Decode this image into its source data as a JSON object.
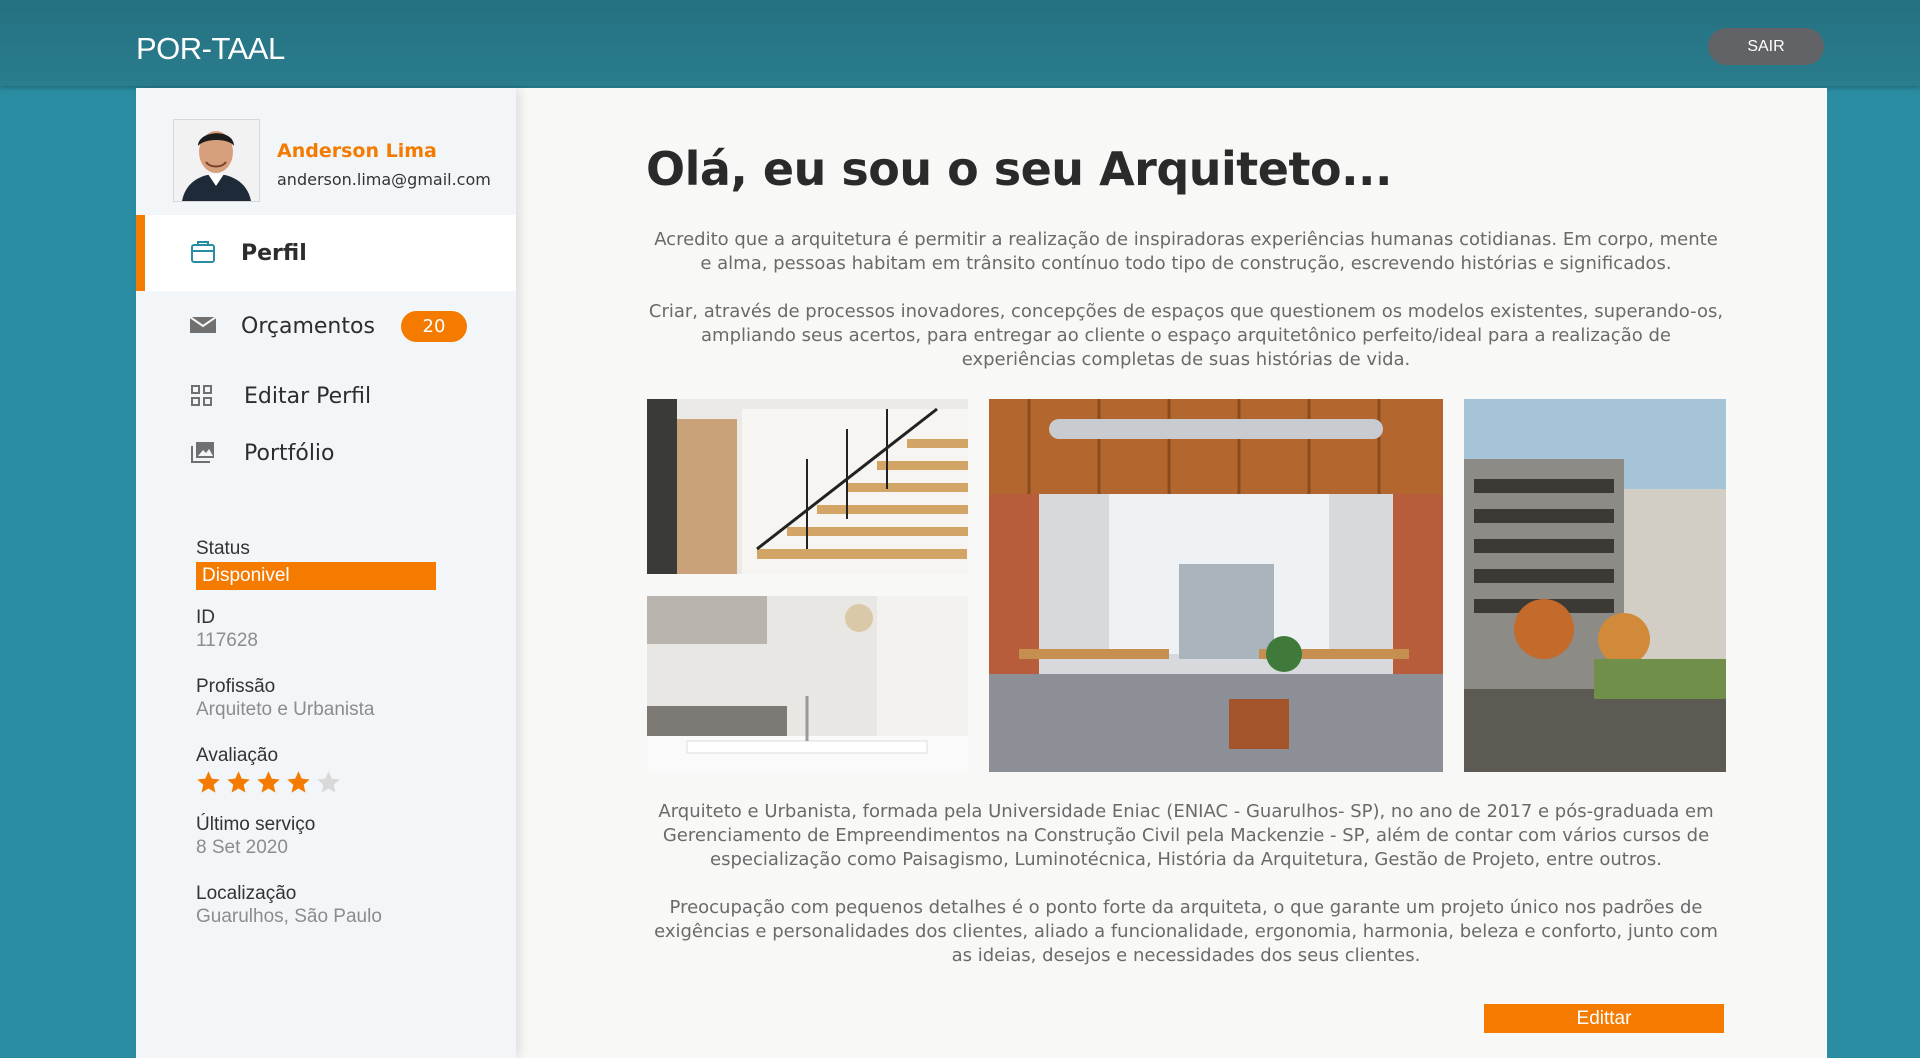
{
  "app": {
    "brand": "POR-TAAL",
    "logout_label": "SAIR"
  },
  "profile": {
    "name": "Anderson Lima",
    "email": "anderson.lima@gmail.com"
  },
  "nav": [
    {
      "label": "Perfil",
      "icon": "profile-icon",
      "active": true
    },
    {
      "label": "Orçamentos",
      "icon": "mail-icon",
      "badge": "20"
    },
    {
      "label": "Editar Perfil",
      "icon": "grid-icon"
    },
    {
      "label": "Portfólio",
      "icon": "image-icon"
    }
  ],
  "info": {
    "status_label": "Status",
    "status_value": "Disponivel",
    "id_label": "ID",
    "id_value": "117628",
    "profession_label": "Profissão",
    "profession_value": "Arquiteto e Urbanista",
    "rating_label": "Avaliação",
    "rating_value": 4,
    "rating_max": 5,
    "last_service_label": "Último serviço",
    "last_service_value": "8 Set 2020",
    "location_label": "Localização",
    "location_value": "Guarulhos, São Paulo"
  },
  "main": {
    "heading": "Olá, eu sou o seu Arquiteto...",
    "intro_1": "Acredito que a arquitetura é permitir a realização de inspiradoras experiências humanas cotidianas. Em corpo, mente e alma, pessoas habitam em trânsito contínuo todo tipo de construção, escrevendo histórias e significados.",
    "intro_2": "Criar, através de processos inovadores, concepções de espaços que questionem os modelos existentes, superando-os, ampliando seus acertos, para entregar ao cliente o espaço arquitetônico perfeito/ideal para a realização de experiências completas de suas histórias de vida.",
    "bio_1": "Arquiteto e Urbanista, formada pela Universidade Eniac (ENIAC - Guarulhos- SP), no ano de 2017 e pós-graduada em Gerenciamento de Empreendimentos na Construção Civil pela Mackenzie - SP, além de contar com vários cursos de especialização como Paisagismo, Luminotécnica, História da Arquitetura, Gestão de Projeto, entre outros.",
    "bio_2": "Preocupação com pequenos detalhes é o ponto forte da arquiteta, o que garante um projeto único nos padrões de exigências e personalidades dos clientes, aliado a funcionalidade, ergonomia, harmonia, beleza e conforto, junto com as ideias, desejos e necessidades dos seus clientes.",
    "edit_label": "Edittar"
  },
  "colors": {
    "accent": "#f47b00",
    "background": "#2a8da2",
    "topbar": "#247181"
  }
}
